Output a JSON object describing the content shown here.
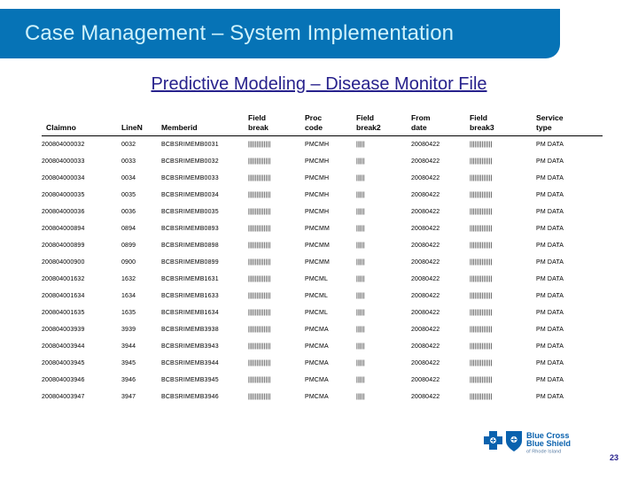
{
  "banner": {
    "title": "Case Management – System Implementation",
    "bg_color": "#0673B6",
    "text_color": "#CFF2FB"
  },
  "subtitle": {
    "text": "Predictive Modeling – Disease Monitor File",
    "color": "#27218C"
  },
  "table": {
    "columns": [
      {
        "key": "claimno",
        "label_line1": "",
        "label_line2": "Claimno"
      },
      {
        "key": "linen",
        "label_line1": "",
        "label_line2": "LineN"
      },
      {
        "key": "memberid",
        "label_line1": "",
        "label_line2": "Memberid"
      },
      {
        "key": "fb1",
        "label_line1": "Field",
        "label_line2": "break"
      },
      {
        "key": "proc",
        "label_line1": "Proc",
        "label_line2": "code"
      },
      {
        "key": "fb2",
        "label_line1": "Field",
        "label_line2": "break2"
      },
      {
        "key": "fromdate",
        "label_line1": "From",
        "label_line2": "date"
      },
      {
        "key": "fb3",
        "label_line1": "Field",
        "label_line2": "break3"
      },
      {
        "key": "svc",
        "label_line1": "Service",
        "label_line2": "type"
      }
    ],
    "field_break_glyph": "|||||||||||||",
    "field_break2_glyph": "|||||",
    "field_break3_glyph": "|||||||||||||",
    "rows": [
      {
        "claimno": "200804000032",
        "linen": "0032",
        "memberid": "BCBSRIMEMB0031",
        "proc": "PMCMH",
        "fromdate": "20080422",
        "svc": "PM DATA"
      },
      {
        "claimno": "200804000033",
        "linen": "0033",
        "memberid": "BCBSRIMEMB0032",
        "proc": "PMCMH",
        "fromdate": "20080422",
        "svc": "PM DATA"
      },
      {
        "claimno": "200804000034",
        "linen": "0034",
        "memberid": "BCBSRIMEMB0033",
        "proc": "PMCMH",
        "fromdate": "20080422",
        "svc": "PM DATA"
      },
      {
        "claimno": "200804000035",
        "linen": "0035",
        "memberid": "BCBSRIMEMB0034",
        "proc": "PMCMH",
        "fromdate": "20080422",
        "svc": "PM DATA"
      },
      {
        "claimno": "200804000036",
        "linen": "0036",
        "memberid": "BCBSRIMEMB0035",
        "proc": "PMCMH",
        "fromdate": "20080422",
        "svc": "PM DATA"
      },
      {
        "claimno": "200804000894",
        "linen": "0894",
        "memberid": "BCBSRIMEMB0893",
        "proc": "PMCMM",
        "fromdate": "20080422",
        "svc": "PM DATA"
      },
      {
        "claimno": "200804000899",
        "linen": "0899",
        "memberid": "BCBSRIMEMB0898",
        "proc": "PMCMM",
        "fromdate": "20080422",
        "svc": "PM DATA"
      },
      {
        "claimno": "200804000900",
        "linen": "0900",
        "memberid": "BCBSRIMEMB0899",
        "proc": "PMCMM",
        "fromdate": "20080422",
        "svc": "PM DATA"
      },
      {
        "claimno": "200804001632",
        "linen": "1632",
        "memberid": "BCBSRIMEMB1631",
        "proc": "PMCML",
        "fromdate": "20080422",
        "svc": "PM DATA"
      },
      {
        "claimno": "200804001634",
        "linen": "1634",
        "memberid": "BCBSRIMEMB1633",
        "proc": "PMCML",
        "fromdate": "20080422",
        "svc": "PM DATA"
      },
      {
        "claimno": "200804001635",
        "linen": "1635",
        "memberid": "BCBSRIMEMB1634",
        "proc": "PMCML",
        "fromdate": "20080422",
        "svc": "PM DATA"
      },
      {
        "claimno": "200804003939",
        "linen": "3939",
        "memberid": "BCBSRIMEMB3938",
        "proc": "PMCMA",
        "fromdate": "20080422",
        "svc": "PM DATA"
      },
      {
        "claimno": "200804003944",
        "linen": "3944",
        "memberid": "BCBSRIMEMB3943",
        "proc": "PMCMA",
        "fromdate": "20080422",
        "svc": "PM DATA"
      },
      {
        "claimno": "200804003945",
        "linen": "3945",
        "memberid": "BCBSRIMEMB3944",
        "proc": "PMCMA",
        "fromdate": "20080422",
        "svc": "PM DATA"
      },
      {
        "claimno": "200804003946",
        "linen": "3946",
        "memberid": "BCBSRIMEMB3945",
        "proc": "PMCMA",
        "fromdate": "20080422",
        "svc": "PM DATA"
      },
      {
        "claimno": "200804003947",
        "linen": "3947",
        "memberid": "BCBSRIMEMB3946",
        "proc": "PMCMA",
        "fromdate": "20080422",
        "svc": "PM DATA"
      }
    ]
  },
  "logo": {
    "brand_line1": "Blue Cross",
    "brand_line2": "Blue Shield",
    "brand_line3": "of Rhode Island",
    "color": "#0A62AE"
  },
  "footer": {
    "page_number": "23"
  }
}
